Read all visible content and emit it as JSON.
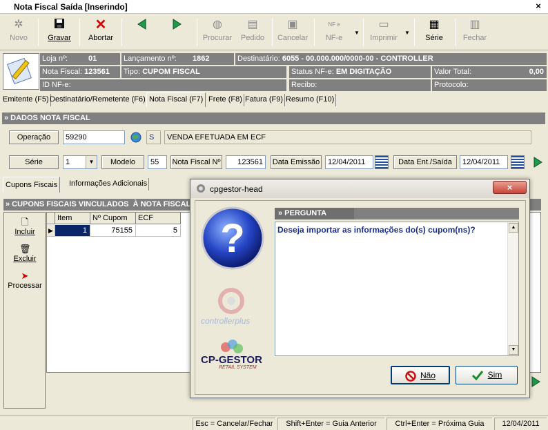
{
  "window": {
    "title": "Nota Fiscal Saída [Inserindo]",
    "close": "×"
  },
  "toolbar": {
    "novo": "Novo",
    "gravar": "Gravar",
    "abortar": "Abortar",
    "procurar": "Procurar",
    "pedido": "Pedido",
    "cancelar": "Cancelar",
    "nfe": "NF-e",
    "imprimir": "Imprimir",
    "serie": "Série",
    "fechar": "Fechar",
    "nfe_icon_text": "NF e"
  },
  "info": {
    "loja_label": "Loja nº:",
    "loja_value": "01",
    "lancamento_label": "Lançamento nº:",
    "lancamento_value": "1862",
    "destinatario_label": "Destinatário:",
    "destinatario_value": "6055 - 00.000.000/0000-00 - CONTROLLER",
    "nota_label": "Nota Fiscal:",
    "nota_value": "123561",
    "tipo_label": "Tipo:",
    "tipo_value": "CUPOM FISCAL",
    "status_label": "Status NF-e:",
    "status_value": "EM DIGITAÇÃO",
    "valor_label": "Valor Total:",
    "valor_value": "0,00",
    "idnfe_label": "ID NF-e:",
    "recibo_label": "Recibo:",
    "protocolo_label": "Protocolo:"
  },
  "tabs": [
    "Emitente (F5)",
    "Destinatário/Remetente (F6)",
    "Nota Fiscal (F7)",
    "Frete (F8)",
    "Fatura (F9)",
    "Resumo (F10)"
  ],
  "section": {
    "title": "» DADOS NOTA FISCAL"
  },
  "form": {
    "operacao_label": "Operação",
    "operacao_value": "59290",
    "operacao_flag": "S",
    "operacao_desc": "VENDA EFETUADA EM ECF",
    "serie_label": "Série",
    "serie_value": "1",
    "modelo_label": "Modelo",
    "modelo_value": "55",
    "numero_label": "Nota Fiscal Nº",
    "numero_value": "123561",
    "emissao_label": "Data Emissão",
    "emissao_value": "12/04/2011",
    "entsaida_label": "Data Ent./Saída",
    "entsaida_value": "12/04/2011"
  },
  "subtabs": [
    "Cupons Fiscais",
    "Informações Adicionais"
  ],
  "cupons": {
    "title": "» CUPONS FISCAIS VINCULADOS  À NOTA FISCAL",
    "actions": {
      "incluir": "Incluir",
      "excluir": "Excluir",
      "processar": "Processar"
    },
    "columns": [
      "Item",
      "Nº Cupom",
      "ECF"
    ],
    "rows": [
      {
        "item": "1",
        "cupom": "75155",
        "ecf": "5"
      }
    ]
  },
  "statusbar": {
    "esc": "Esc = Cancelar/Fechar",
    "shift": "Shift+Enter = Guia Anterior",
    "ctrl": "Ctrl+Enter = Próxima Guia",
    "date": "12/04/2011"
  },
  "dialog": {
    "title": "cpgestor-head",
    "close": "×",
    "section": "» PERGUNTA",
    "message": "Deseja importar as informações do(s) cupom(ns)?",
    "logo1": "controllerplus",
    "logo2": "CP-GESTOR",
    "logo2_sub": "RETAIL SYSTEM",
    "no_label": "Não",
    "yes_label": "Sim"
  },
  "colors": {
    "accent": "#1a2f8c",
    "panel": "#808080",
    "bg": "#ece9d8"
  }
}
